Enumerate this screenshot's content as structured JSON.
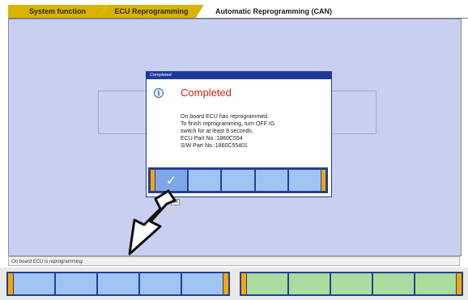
{
  "tabs": [
    {
      "label": "System function"
    },
    {
      "label": "ECU Reprogramming"
    },
    {
      "label": "Automatic Reprogramming (CAN)"
    }
  ],
  "dialog": {
    "title": "Completed",
    "icon": "info-icon",
    "heading": "Completed",
    "lines": [
      "On board ECU has reprogrammed.",
      "To finish reprogramming, turn OFF IG",
      "switch for at least 8 seconds.",
      "ECU Part No.:1860C554",
      "S/W Part No.:1860C55401"
    ],
    "ok_caption": "OK"
  },
  "status_text": "On board ECU is reprogramming.",
  "colors": {
    "tab_active": "#d9b300",
    "workspace": "#c9cfee",
    "dialog_titlebar": "#1d3a9a",
    "heading_red": "#d11c1c",
    "button_blue": "#9ec4f1",
    "button_green": "#a9dd9d",
    "accent_orange": "#f2a800"
  }
}
